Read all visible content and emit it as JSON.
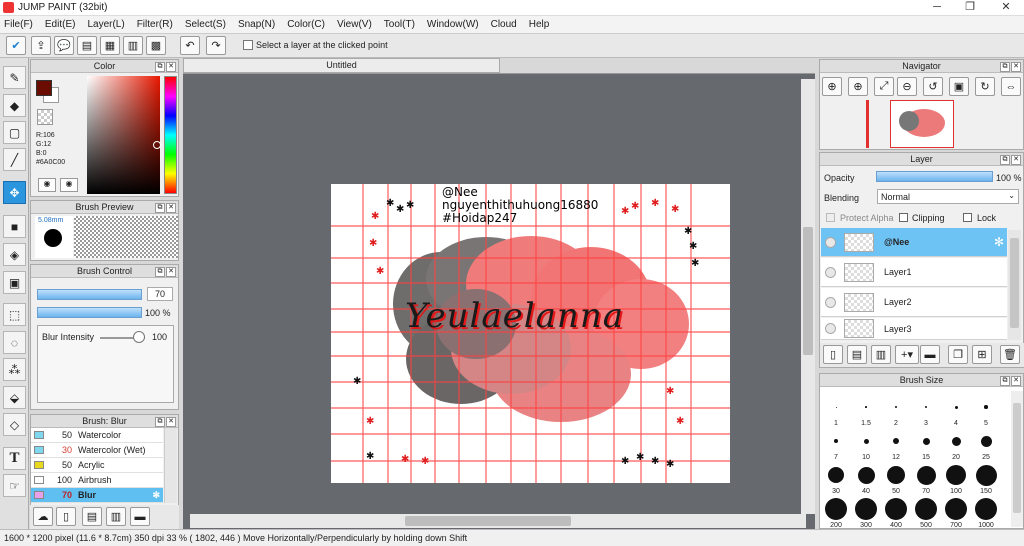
{
  "window": {
    "title": "JUMP PAINT (32bit)",
    "minimize": "─",
    "maximize": "❐",
    "close": "✕"
  },
  "menu": [
    "File(F)",
    "Edit(E)",
    "Layer(L)",
    "Filter(R)",
    "Select(S)",
    "Snap(N)",
    "Color(C)",
    "View(V)",
    "Tool(T)",
    "Window(W)",
    "Cloud",
    "Help"
  ],
  "toolbar": {
    "select_layer_label": "Select a layer at the clicked point"
  },
  "color_panel": {
    "title": "Color",
    "r": "R:106",
    "g": "G:12",
    "b": "B:0",
    "hex": "#6A0C00",
    "main_color": "#6a0c00"
  },
  "brush_preview": {
    "title": "Brush Preview",
    "size": "5.08mm"
  },
  "brush_control": {
    "title": "Brush Control",
    "size_value": "70",
    "opacity_value": "100 %",
    "blur_label": "Blur Intensity",
    "blur_value": "100"
  },
  "brush_list": {
    "title": "Brush: Blur",
    "items": [
      {
        "size": "50",
        "name": "Watercolor",
        "color": "#7fd8f0"
      },
      {
        "size": "30",
        "name": "Watercolor (Wet)",
        "color": "#7fd8f0"
      },
      {
        "size": "50",
        "name": "Acrylic",
        "color": "#e8d820"
      },
      {
        "size": "100",
        "name": "Airbrush",
        "color": "#ffffff"
      },
      {
        "size": "70",
        "name": "Blur",
        "color": "#e8a0e8"
      }
    ]
  },
  "document": {
    "tab": "Untitled"
  },
  "canvas_text": {
    "line1": "@Nee",
    "line2": "nguyenthithuhuong16880",
    "line3": "#Hoidap247",
    "signature": "Yeulaelanna"
  },
  "navigator": {
    "title": "Navigator"
  },
  "layer_panel": {
    "title": "Layer",
    "opacity_label": "Opacity",
    "opacity_value": "100 %",
    "blending_label": "Blending",
    "blending_value": "Normal",
    "protect_alpha": "Protect Alpha",
    "clipping": "Clipping",
    "lock": "Lock",
    "layers": [
      "@Nee",
      "Layer1",
      "Layer2",
      "Layer3"
    ]
  },
  "brush_size": {
    "title": "Brush Size",
    "sizes": [
      "1",
      "1.5",
      "2",
      "3",
      "4",
      "5",
      "7",
      "10",
      "12",
      "15",
      "20",
      "25",
      "30",
      "40",
      "50",
      "70",
      "100",
      "150",
      "200",
      "300",
      "400",
      "500",
      "700",
      "1000"
    ]
  },
  "status": {
    "text": "1600 * 1200 pixel   (11.6 * 8.7cm)   350 dpi   33 %   ( 1802, 446 )   Move Horizontally/Perpendicularly by holding down Shift"
  }
}
